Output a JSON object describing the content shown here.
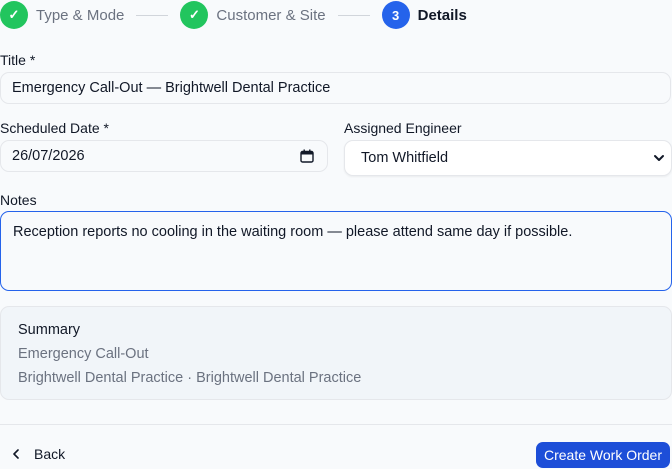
{
  "stepper": {
    "steps": [
      {
        "marker": "✓",
        "label": "Type & Mode",
        "state": "done"
      },
      {
        "marker": "✓",
        "label": "Customer & Site",
        "state": "done"
      },
      {
        "marker": "3",
        "label": "Details",
        "state": "active"
      }
    ]
  },
  "form": {
    "title_label": "Title *",
    "title_value": "Emergency Call-Out — Brightwell Dental Practice",
    "date_label": "Scheduled Date *",
    "date_value": "26/07/2026",
    "engineer_label": "Assigned Engineer",
    "engineer_value": "Tom Whitfield",
    "notes_label": "Notes",
    "notes_value": "Reception reports no cooling in the waiting room — please attend same day if possible."
  },
  "summary": {
    "title": "Summary",
    "line1": "Emergency Call-Out",
    "line2": "Brightwell Dental Practice · Brightwell Dental Practice"
  },
  "footer": {
    "back_label": "Back",
    "submit_label": "Create Work Order"
  },
  "colors": {
    "done": "#22c55e",
    "active": "#2563eb",
    "primary_button": "#1d4ed8",
    "focus_border": "#2563eb"
  },
  "icons": {
    "step_done": "check-icon",
    "date": "calendar-icon",
    "select": "chevron-down-icon",
    "back": "chevron-left-icon"
  }
}
